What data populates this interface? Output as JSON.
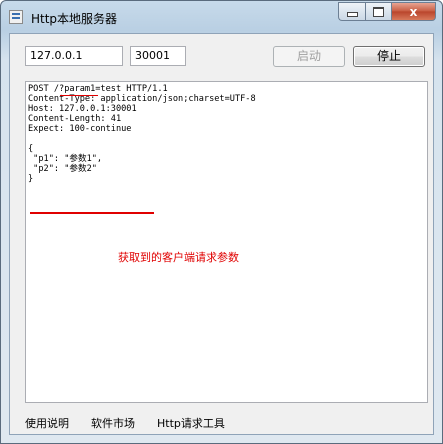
{
  "window": {
    "title": "Http本地服务器",
    "app_icon": "app-window-icon",
    "controls": {
      "minimize_icon": "minimize-icon",
      "maximize_icon": "maximize-icon",
      "close_icon": "close-icon",
      "close_glyph": "x"
    }
  },
  "server": {
    "ip": "127.0.0.1",
    "port": "30001",
    "start_label": "启动",
    "stop_label": "停止"
  },
  "log": {
    "lines": [
      "POST /?param1=test HTTP/1.1",
      "Content-Type: application/json;charset=UTF-8",
      "Host: 127.0.0.1:30001",
      "Content-Length: 41",
      "Expect: 100-continue",
      "",
      "{",
      " \"p1\": \"参数1\",",
      " \"p2\": \"参数2\"",
      "}"
    ],
    "annotation": "获取到的客户端请求参数",
    "accent_color": "#e00000"
  },
  "menu": {
    "items": [
      "使用说明",
      "软件市场",
      "Http请求工具"
    ]
  }
}
